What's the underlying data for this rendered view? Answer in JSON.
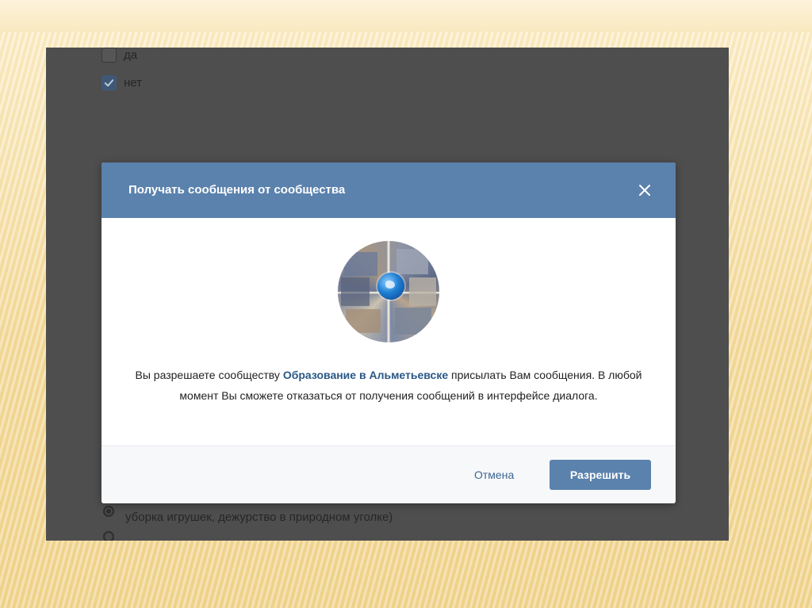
{
  "form": {
    "option_yes": "да",
    "option_no": "нет",
    "bottom_text": "уборка игрушек, дежурство в природном уголке)"
  },
  "modal": {
    "title": "Получать сообщения от сообщества",
    "message_prefix": "Вы разрешаете сообществу ",
    "group_name": "Образование в Альметьевске",
    "message_suffix": " присылать Вам сообщения. В любой момент Вы сможете отказаться от получения сообщений в интерфейсе диалога.",
    "cancel_label": "Отмена",
    "allow_label": "Разрешить"
  },
  "icons": {
    "close": "close-icon",
    "checkmark": "checkmark-icon",
    "avatar": "community-avatar"
  },
  "colors": {
    "header": "#5b82ad",
    "link": "#2a5885",
    "button": "#5b82ad",
    "overlay": "#4e4e4e"
  }
}
